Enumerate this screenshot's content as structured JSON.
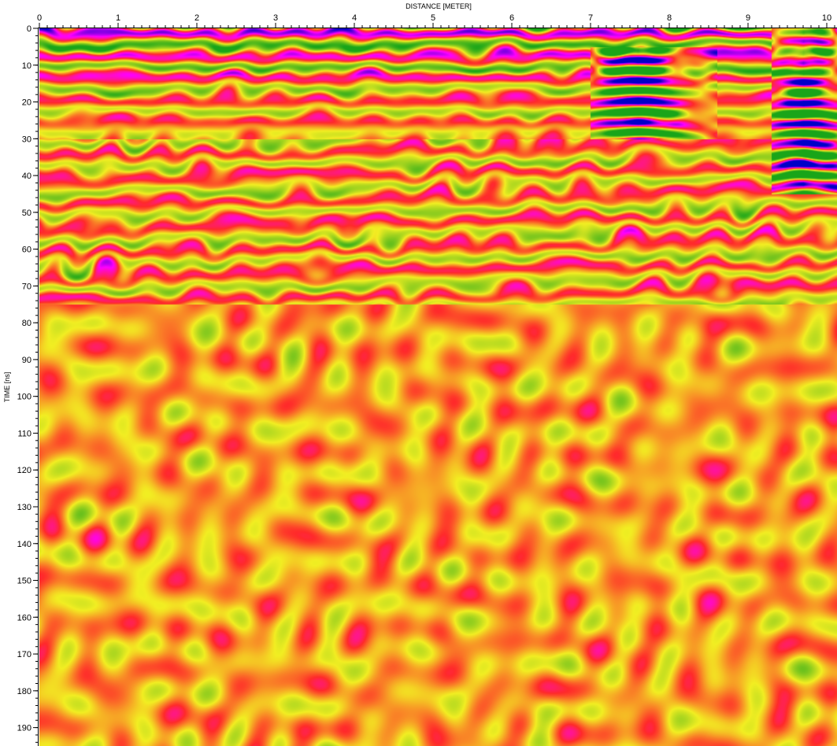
{
  "chart_data": {
    "type": "heatmap",
    "title": "",
    "xlabel": "DISTANCE [METER]",
    "ylabel": "TIME [ns]",
    "x_axis_position": "top",
    "xlim": [
      0,
      10.13
    ],
    "ylim": [
      0,
      195
    ],
    "y_inverted": true,
    "x_ticks": [
      0,
      1,
      2,
      3,
      4,
      5,
      6,
      7,
      8,
      9,
      10
    ],
    "x_tick_labels": [
      "0",
      "1",
      "2",
      "3",
      "4",
      "5",
      "6",
      "7",
      "8",
      "9",
      "10"
    ],
    "y_ticks": [
      0,
      10,
      20,
      30,
      40,
      50,
      60,
      70,
      80,
      90,
      100,
      110,
      120,
      130,
      140,
      150,
      160,
      170,
      180,
      190
    ],
    "y_tick_labels": [
      "0",
      "10",
      "20",
      "30",
      "40",
      "50",
      "60",
      "70",
      "80",
      "90",
      "100",
      "110",
      "120",
      "130",
      "140",
      "150",
      "160",
      "170",
      "180",
      "190"
    ],
    "colormap": [
      "#0000c8",
      "#ff00ff",
      "#ff2a2a",
      "#f2ee22",
      "#19a519"
    ],
    "background_color": "#f2ee22",
    "features": [
      {
        "name": "direct-wave band",
        "time_range": [
          0,
          30
        ],
        "distance_range": [
          0,
          10.13
        ],
        "strength": 0.8
      },
      {
        "name": "strong hyperbolic reflection",
        "apex_distance": 7.6,
        "apex_time": 13,
        "time_range": [
          5,
          30
        ],
        "distance_range": [
          7.0,
          8.6
        ],
        "strength": 1.0
      },
      {
        "name": "strong hyperbolic reflection",
        "apex_distance": 9.7,
        "apex_time": 8,
        "time_range": [
          0,
          45
        ],
        "distance_range": [
          9.3,
          10.13
        ],
        "strength": 1.0
      },
      {
        "name": "layered reflections",
        "time_range": [
          30,
          75
        ],
        "distance_range": [
          0,
          10.13
        ],
        "strength": 0.45
      },
      {
        "name": "noise",
        "time_range": [
          75,
          195
        ],
        "distance_range": [
          0,
          10.13
        ],
        "strength": 0.25
      }
    ]
  }
}
